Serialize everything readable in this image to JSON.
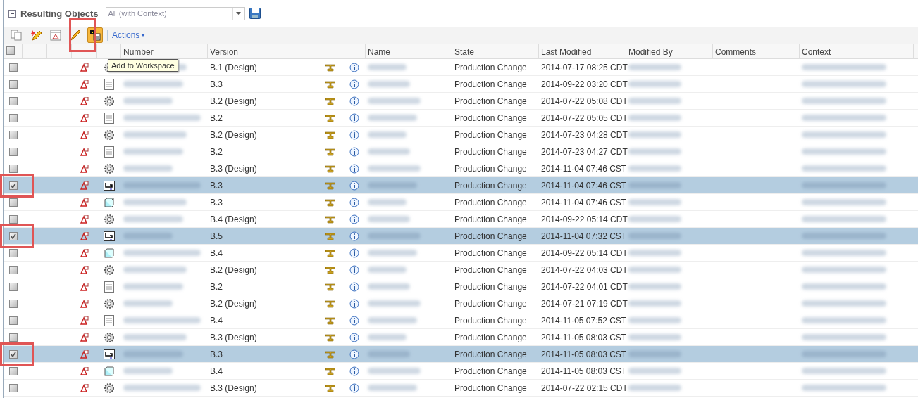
{
  "panel": {
    "title": "Resulting Objects",
    "expanded": true,
    "filter": "All (with Context)"
  },
  "toolbar": {
    "actions_label": "Actions",
    "tooltip": "Add to Workspace"
  },
  "table": {
    "select_all": {
      "checked": false
    },
    "columns": [
      "Number",
      "Version",
      "Name",
      "State",
      "Last Modified",
      "Modified By",
      "Comments",
      "Context"
    ],
    "rows": [
      {
        "kind": "gear",
        "selected": false,
        "version": "B.1 (Design)",
        "state": "Production Change",
        "modified": "2014-07-17 08:25 CDT"
      },
      {
        "kind": "document",
        "selected": false,
        "version": "B.3",
        "state": "Production Change",
        "modified": "2014-09-22 03:20 CDT"
      },
      {
        "kind": "gear",
        "selected": false,
        "version": "B.2 (Design)",
        "state": "Production Change",
        "modified": "2014-07-22 05:08 CDT"
      },
      {
        "kind": "document",
        "selected": false,
        "version": "B.2",
        "state": "Production Change",
        "modified": "2014-07-22 05:05 CDT"
      },
      {
        "kind": "gear",
        "selected": false,
        "version": "B.2 (Design)",
        "state": "Production Change",
        "modified": "2014-07-23 04:28 CDT"
      },
      {
        "kind": "document",
        "selected": false,
        "version": "B.2",
        "state": "Production Change",
        "modified": "2014-07-23 04:27 CDT"
      },
      {
        "kind": "gear",
        "selected": false,
        "version": "B.3 (Design)",
        "state": "Production Change",
        "modified": "2014-11-04 07:46 CST"
      },
      {
        "kind": "drawing",
        "selected": true,
        "version": "B.3",
        "state": "Production Change",
        "modified": "2014-11-04 07:46 CST"
      },
      {
        "kind": "part",
        "selected": false,
        "version": "B.3",
        "state": "Production Change",
        "modified": "2014-11-04 07:46 CST"
      },
      {
        "kind": "gear",
        "selected": false,
        "version": "B.4 (Design)",
        "state": "Production Change",
        "modified": "2014-09-22 05:14 CDT"
      },
      {
        "kind": "drawing",
        "selected": true,
        "version": "B.5",
        "state": "Production Change",
        "modified": "2014-11-04 07:32 CST"
      },
      {
        "kind": "part",
        "selected": false,
        "version": "B.4",
        "state": "Production Change",
        "modified": "2014-09-22 05:14 CDT"
      },
      {
        "kind": "gear",
        "selected": false,
        "version": "B.2 (Design)",
        "state": "Production Change",
        "modified": "2014-07-22 04:03 CDT"
      },
      {
        "kind": "document",
        "selected": false,
        "version": "B.2",
        "state": "Production Change",
        "modified": "2014-07-22 04:01 CDT"
      },
      {
        "kind": "gear",
        "selected": false,
        "version": "B.2 (Design)",
        "state": "Production Change",
        "modified": "2014-07-21 07:19 CDT"
      },
      {
        "kind": "document",
        "selected": false,
        "version": "B.4",
        "state": "Production Change",
        "modified": "2014-11-05 07:52 CST"
      },
      {
        "kind": "gear",
        "selected": false,
        "version": "B.3 (Design)",
        "state": "Production Change",
        "modified": "2014-11-05 08:03 CST"
      },
      {
        "kind": "drawing",
        "selected": true,
        "version": "B.3",
        "state": "Production Change",
        "modified": "2014-11-05 08:03 CST"
      },
      {
        "kind": "part",
        "selected": false,
        "version": "B.4",
        "state": "Production Change",
        "modified": "2014-11-05 08:03 CST"
      },
      {
        "kind": "gear",
        "selected": false,
        "version": "B.3 (Design)",
        "state": "Production Change",
        "modified": "2014-07-22 02:15 CDT"
      }
    ]
  }
}
